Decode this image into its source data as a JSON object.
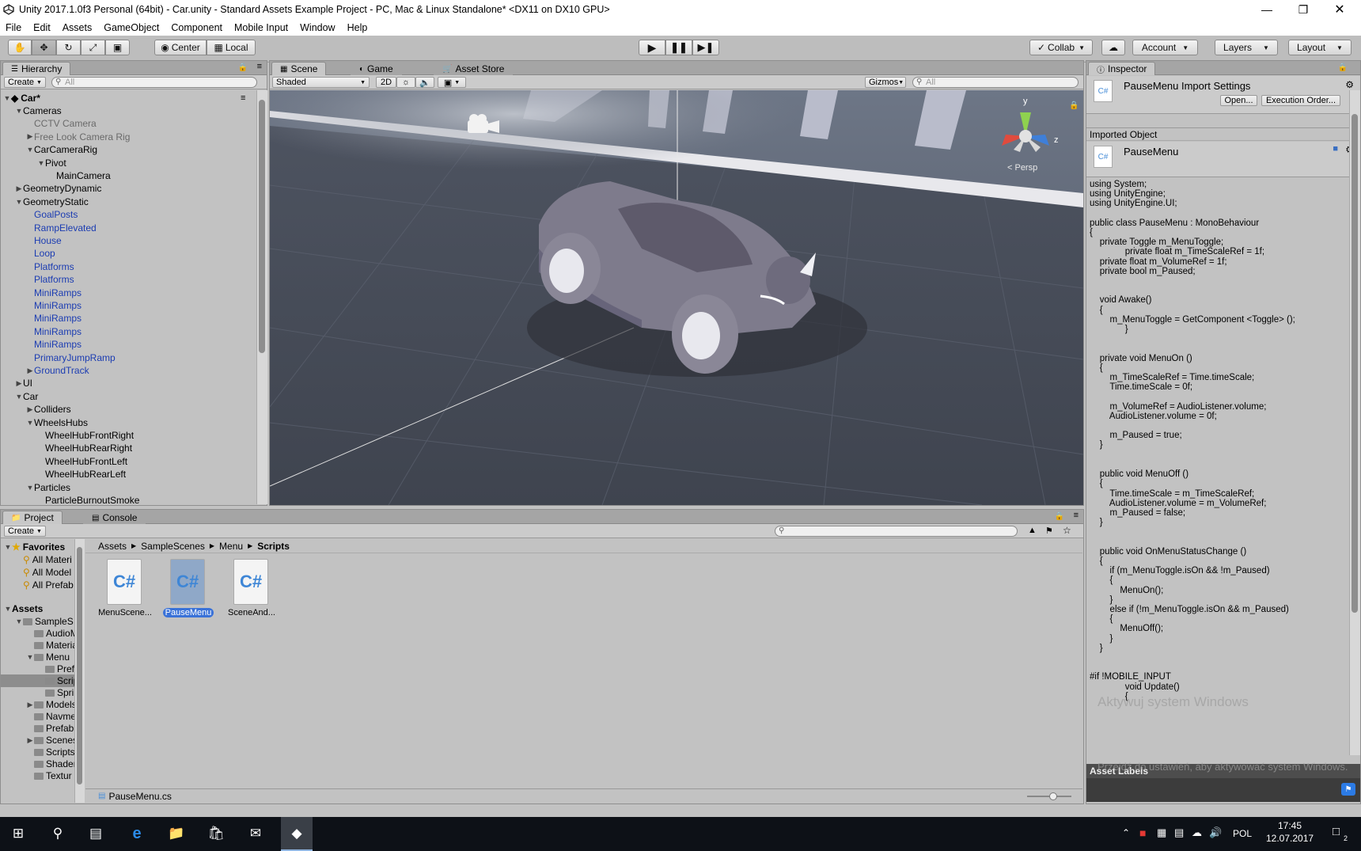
{
  "window": {
    "title": "Unity 2017.1.0f3 Personal (64bit) - Car.unity - Standard Assets Example Project - PC, Mac & Linux Standalone* <DX11 on DX10 GPU>",
    "minimize_icon": "minimize-icon",
    "maximize_icon": "maximize-icon",
    "close_icon": "close-icon"
  },
  "menubar": [
    "File",
    "Edit",
    "Assets",
    "GameObject",
    "Component",
    "Mobile Input",
    "Window",
    "Help"
  ],
  "toolbar": {
    "center_label": "Center",
    "local_label": "Local",
    "collab_label": "Collab",
    "account_label": "Account",
    "layers_label": "Layers",
    "layout_label": "Layout"
  },
  "hierarchy": {
    "tab": "Hierarchy",
    "create": "Create",
    "search_placeholder": "All",
    "scene_name": "Car*",
    "items": [
      {
        "label": "Cameras",
        "indent": 1,
        "arrow": "open",
        "style": "normal"
      },
      {
        "label": "CCTV Camera",
        "indent": 2,
        "arrow": "none",
        "style": "gray"
      },
      {
        "label": "Free Look Camera Rig",
        "indent": 2,
        "arrow": "closed",
        "style": "gray"
      },
      {
        "label": "CarCameraRig",
        "indent": 2,
        "arrow": "open",
        "style": "normal"
      },
      {
        "label": "Pivot",
        "indent": 3,
        "arrow": "open",
        "style": "normal"
      },
      {
        "label": "MainCamera",
        "indent": 4,
        "arrow": "none",
        "style": "normal"
      },
      {
        "label": "GeometryDynamic",
        "indent": 1,
        "arrow": "closed",
        "style": "normal"
      },
      {
        "label": "GeometryStatic",
        "indent": 1,
        "arrow": "open",
        "style": "normal"
      },
      {
        "label": "GoalPosts",
        "indent": 2,
        "arrow": "none",
        "style": "blue"
      },
      {
        "label": "RampElevated",
        "indent": 2,
        "arrow": "none",
        "style": "blue"
      },
      {
        "label": "House",
        "indent": 2,
        "arrow": "none",
        "style": "blue"
      },
      {
        "label": "Loop",
        "indent": 2,
        "arrow": "none",
        "style": "blue"
      },
      {
        "label": "Platforms",
        "indent": 2,
        "arrow": "none",
        "style": "blue"
      },
      {
        "label": "Platforms",
        "indent": 2,
        "arrow": "none",
        "style": "blue"
      },
      {
        "label": "MiniRamps",
        "indent": 2,
        "arrow": "none",
        "style": "blue"
      },
      {
        "label": "MiniRamps",
        "indent": 2,
        "arrow": "none",
        "style": "blue"
      },
      {
        "label": "MiniRamps",
        "indent": 2,
        "arrow": "none",
        "style": "blue"
      },
      {
        "label": "MiniRamps",
        "indent": 2,
        "arrow": "none",
        "style": "blue"
      },
      {
        "label": "MiniRamps",
        "indent": 2,
        "arrow": "none",
        "style": "blue"
      },
      {
        "label": "PrimaryJumpRamp",
        "indent": 2,
        "arrow": "none",
        "style": "blue"
      },
      {
        "label": "GroundTrack",
        "indent": 2,
        "arrow": "closed",
        "style": "blue"
      },
      {
        "label": "UI",
        "indent": 1,
        "arrow": "closed",
        "style": "normal"
      },
      {
        "label": "Car",
        "indent": 1,
        "arrow": "open",
        "style": "normal"
      },
      {
        "label": "Colliders",
        "indent": 2,
        "arrow": "closed",
        "style": "normal"
      },
      {
        "label": "WheelsHubs",
        "indent": 2,
        "arrow": "open",
        "style": "normal"
      },
      {
        "label": "WheelHubFrontRight",
        "indent": 3,
        "arrow": "none",
        "style": "normal"
      },
      {
        "label": "WheelHubRearRight",
        "indent": 3,
        "arrow": "none",
        "style": "normal"
      },
      {
        "label": "WheelHubFrontLeft",
        "indent": 3,
        "arrow": "none",
        "style": "normal"
      },
      {
        "label": "WheelHubRearLeft",
        "indent": 3,
        "arrow": "none",
        "style": "normal"
      },
      {
        "label": "Particles",
        "indent": 2,
        "arrow": "open",
        "style": "normal"
      },
      {
        "label": "ParticleBurnoutSmoke",
        "indent": 3,
        "arrow": "none",
        "style": "normal"
      }
    ]
  },
  "scene": {
    "tabs": [
      "Scene",
      "Game",
      "Asset Store"
    ],
    "shading": "Shaded",
    "mode_2d": "2D",
    "gizmos": "Gizmos",
    "search_placeholder": "All",
    "persp_label": "< Persp",
    "axis_y": "y",
    "axis_z": "z"
  },
  "project": {
    "tabs": [
      "Project",
      "Console"
    ],
    "create": "Create",
    "favorites_label": "Favorites",
    "favorites": [
      "All Materi",
      "All Model",
      "All Prefab"
    ],
    "assets_label": "Assets",
    "folders": [
      {
        "label": "SampleS",
        "indent": 1,
        "arrow": "open"
      },
      {
        "label": "AudioM",
        "indent": 2,
        "arrow": "none"
      },
      {
        "label": "Materia",
        "indent": 2,
        "arrow": "none"
      },
      {
        "label": "Menu",
        "indent": 2,
        "arrow": "open"
      },
      {
        "label": "Pref",
        "indent": 3,
        "arrow": "none"
      },
      {
        "label": "Scrip",
        "indent": 3,
        "arrow": "none"
      },
      {
        "label": "Spri",
        "indent": 3,
        "arrow": "none"
      },
      {
        "label": "Models",
        "indent": 2,
        "arrow": "closed"
      },
      {
        "label": "Navme",
        "indent": 2,
        "arrow": "none"
      },
      {
        "label": "Prefab",
        "indent": 2,
        "arrow": "none"
      },
      {
        "label": "Scenes",
        "indent": 2,
        "arrow": "closed"
      },
      {
        "label": "Scripts",
        "indent": 2,
        "arrow": "none"
      },
      {
        "label": "Shader",
        "indent": 2,
        "arrow": "none"
      },
      {
        "label": "Textur",
        "indent": 2,
        "arrow": "none"
      }
    ],
    "breadcrumb": [
      "Assets",
      "SampleScenes",
      "Menu",
      "Scripts"
    ],
    "files": [
      {
        "label": "MenuScene...",
        "selected": false
      },
      {
        "label": "PauseMenu",
        "selected": true
      },
      {
        "label": "SceneAnd...",
        "selected": false
      }
    ],
    "footer_file": "PauseMenu.cs"
  },
  "inspector": {
    "tab": "Inspector",
    "import_title": "PauseMenu Import Settings",
    "open_button": "Open...",
    "exec_order_button": "Execution Order...",
    "imported_object": "Imported Object",
    "object_name": "PauseMenu",
    "code": "using System;\nusing UnityEngine;\nusing UnityEngine.UI;\n\npublic class PauseMenu : MonoBehaviour\n{\n    private Toggle m_MenuToggle;\n              private float m_TimeScaleRef = 1f;\n    private float m_VolumeRef = 1f;\n    private bool m_Paused;\n\n\n    void Awake()\n    {\n        m_MenuToggle = GetComponent <Toggle> ();\n              }\n\n\n    private void MenuOn ()\n    {\n        m_TimeScaleRef = Time.timeScale;\n        Time.timeScale = 0f;\n\n        m_VolumeRef = AudioListener.volume;\n        AudioListener.volume = 0f;\n\n        m_Paused = true;\n    }\n\n\n    public void MenuOff ()\n    {\n        Time.timeScale = m_TimeScaleRef;\n        AudioListener.volume = m_VolumeRef;\n        m_Paused = false;\n    }\n\n\n    public void OnMenuStatusChange ()\n    {\n        if (m_MenuToggle.isOn && !m_Paused)\n        {\n            MenuOn();\n        }\n        else if (!m_MenuToggle.isOn && m_Paused)\n        {\n            MenuOff();\n        }\n    }\n\n\n#if !MOBILE_INPUT\n              void Update()\n              {",
    "asset_labels": "Asset Labels",
    "watermark_line1": "Aktywuj system Windows",
    "watermark_line2": "Przejdź do ustawień, aby aktywować system Windows."
  },
  "taskbar": {
    "language": "POL",
    "time": "17:45",
    "date": "12.07.2017",
    "notification_count": "2"
  }
}
